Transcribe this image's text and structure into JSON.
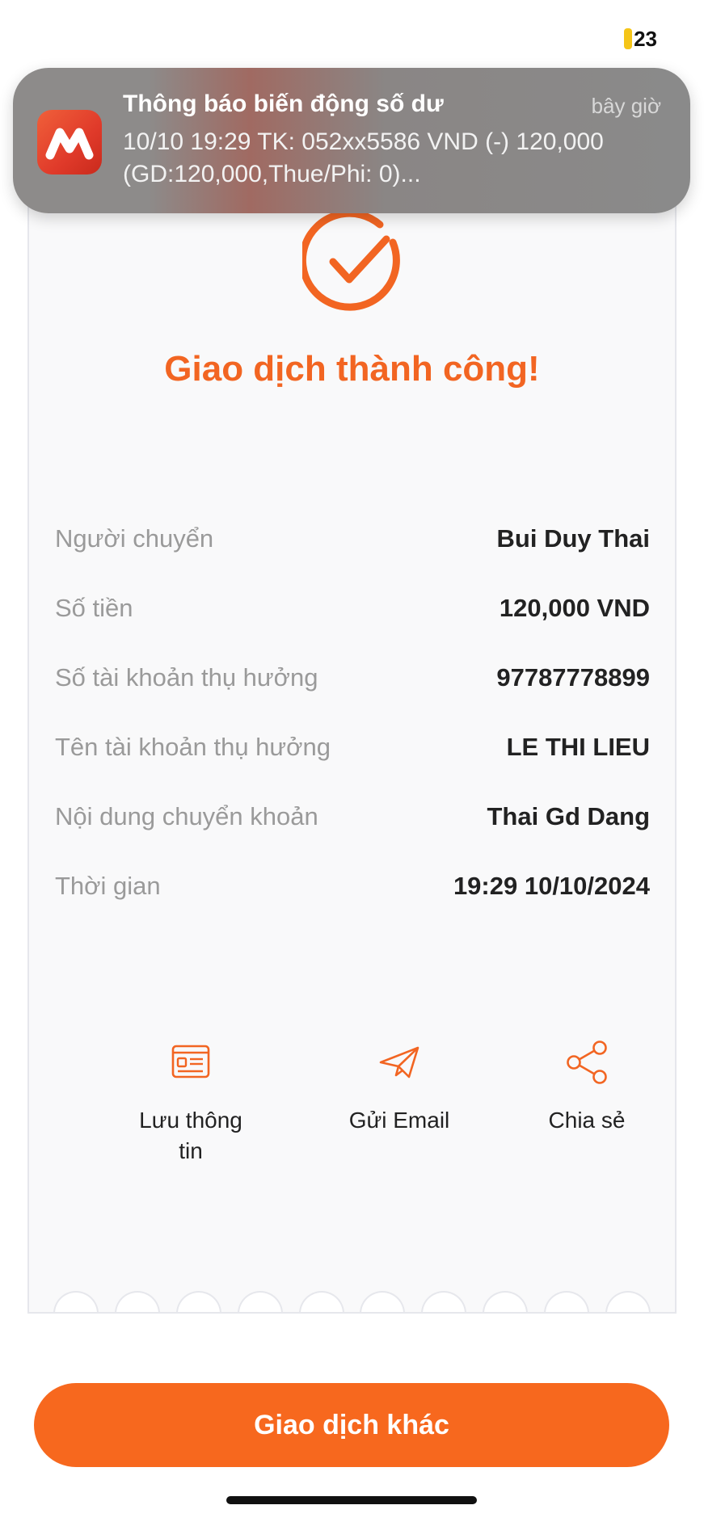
{
  "status_bar": {
    "battery_level": "23"
  },
  "notification": {
    "app_icon": "bank-app-icon",
    "title": "Thông báo biến động số dư",
    "time": "bây giờ",
    "line1": "10/10 19:29 TK: 052xx5586 VND (-) 120,000",
    "line2": "(GD:120,000,Thue/Phi: 0)..."
  },
  "receipt": {
    "status_icon": "check-circle-icon",
    "title": "Giao dịch thành công!",
    "rows": [
      {
        "label": "Người chuyển",
        "value": "Bui Duy Thai"
      },
      {
        "label": "Số tiền",
        "value": "120,000 VND"
      },
      {
        "label": "Số tài khoản thụ hưởng",
        "value": "97787778899"
      },
      {
        "label": "Tên tài khoản thụ hưởng",
        "value": "LE THI LIEU"
      },
      {
        "label": "Nội dung chuyển khoản",
        "value": "Thai Gd Dang"
      },
      {
        "label": "Thời gian",
        "value": "19:29 10/10/2024"
      }
    ],
    "actions": [
      {
        "icon": "id-card-icon",
        "label_line1": "Lưu thông",
        "label_line2": "tin"
      },
      {
        "icon": "paper-plane-icon",
        "label": "Gửi Email"
      },
      {
        "icon": "share-icon",
        "label": "Chia sẻ"
      }
    ]
  },
  "footer": {
    "primary_button": "Giao dịch khác"
  },
  "colors": {
    "accent": "#f26522",
    "button": "#f7681e"
  }
}
